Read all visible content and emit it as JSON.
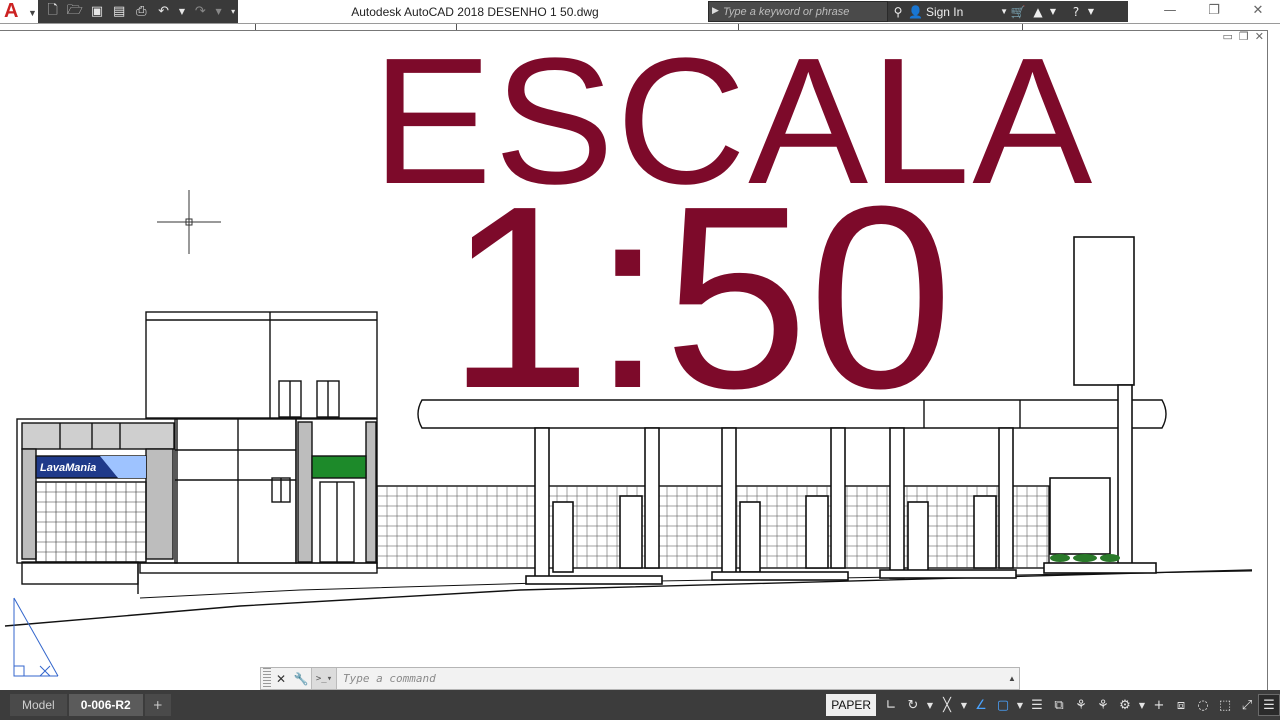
{
  "app": {
    "logo": "A",
    "window_title": "Autodesk AutoCAD 2018    DESENHO 1 50.dwg"
  },
  "quick_access": {
    "icons": [
      "new-icon",
      "open-icon",
      "save-icon",
      "save-as-icon",
      "plot-icon",
      "undo-icon",
      "redo-icon",
      "customize-icon"
    ]
  },
  "search": {
    "placeholder": "Type a keyword or phrase"
  },
  "infocenter": {
    "signin_label": "Sign In"
  },
  "drawing": {
    "title_line1": "ESCALA",
    "title_line2": "1:50",
    "title_color": "#7d0a2a",
    "sign_text": "LavaMania"
  },
  "command_line": {
    "placeholder": "Type a command"
  },
  "status": {
    "tabs": [
      "Model",
      "0-006-R2",
      "+"
    ],
    "active_tab": "0-006-R2",
    "paper_label": "PAPER"
  }
}
